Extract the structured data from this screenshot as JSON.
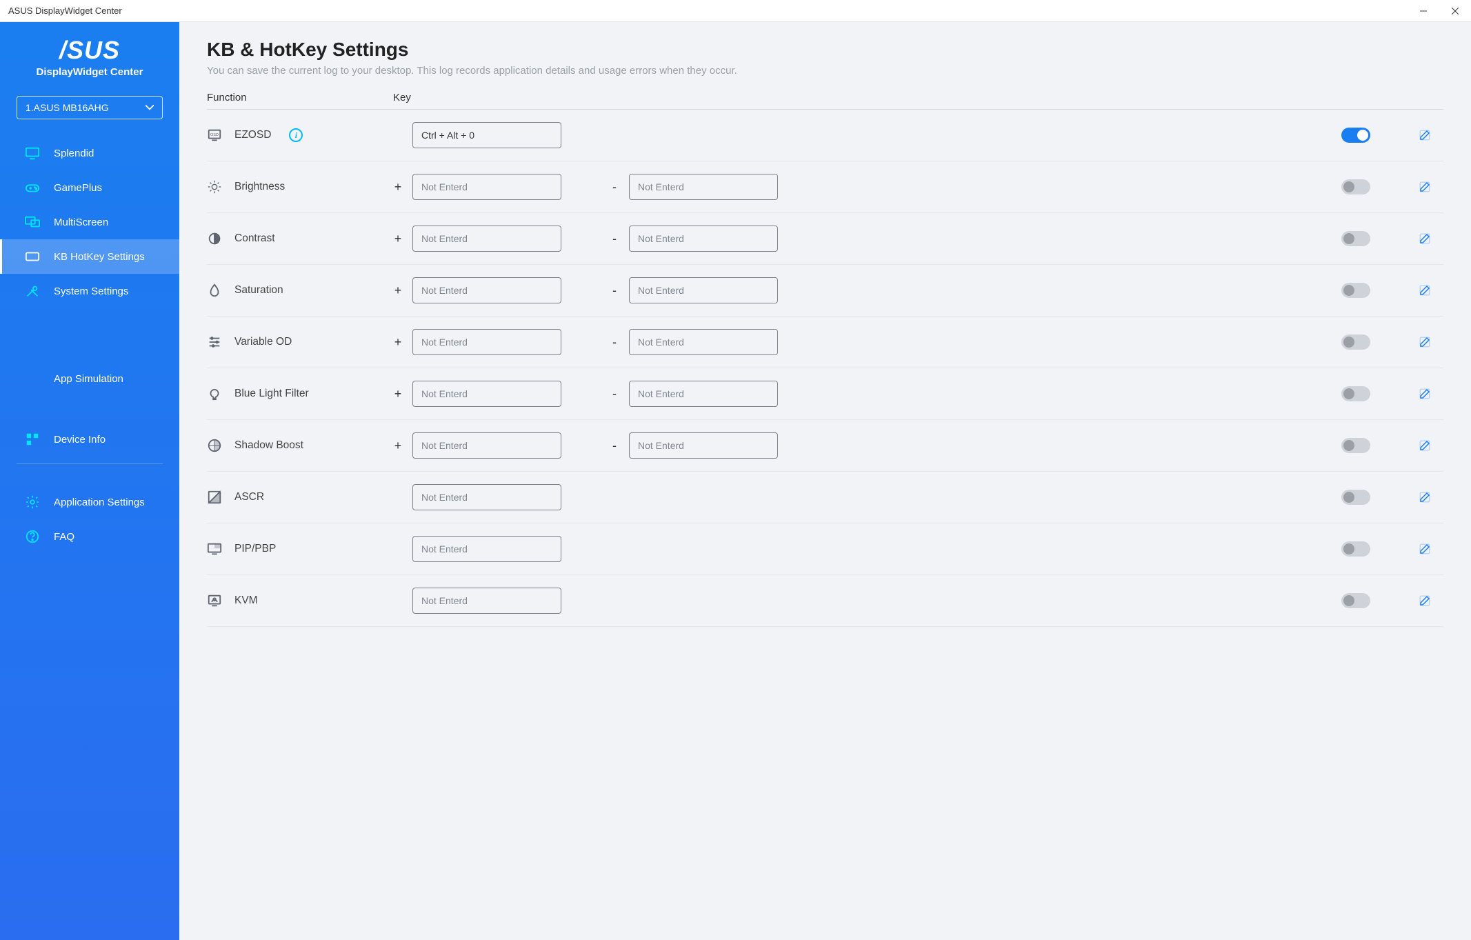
{
  "window": {
    "title": "ASUS DisplayWidget Center"
  },
  "sidebar": {
    "logo_main": "/SUS",
    "logo_sub": "DisplayWidget Center",
    "device_selected": "1.ASUS MB16AHG",
    "nav": [
      {
        "label": "Splendid"
      },
      {
        "label": "GamePlus"
      },
      {
        "label": "MultiScreen"
      },
      {
        "label": "KB HotKey Settings"
      },
      {
        "label": "System Settings"
      }
    ],
    "app_sim": "App Simulation",
    "device_info": "Device Info",
    "app_settings": "Application Settings",
    "faq": "FAQ"
  },
  "main": {
    "title": "KB & HotKey Settings",
    "subtitle": "You can save the current log to your desktop. This log records application details and usage errors when they occur.",
    "column_function": "Function",
    "column_key": "Key",
    "placeholder": "Not Enterd",
    "plus_sign": "+",
    "minus_sign": "-",
    "rows": [
      {
        "label": "EZOSD",
        "info": true,
        "single": true,
        "value": "Ctrl + Alt + 0",
        "toggle": true
      },
      {
        "label": "Brightness",
        "dual": true,
        "toggle": false
      },
      {
        "label": "Contrast",
        "dual": true,
        "toggle": false
      },
      {
        "label": "Saturation",
        "dual": true,
        "toggle": false
      },
      {
        "label": "Variable OD",
        "dual": true,
        "toggle": false
      },
      {
        "label": "Blue Light Filter",
        "dual": true,
        "toggle": false
      },
      {
        "label": "Shadow Boost",
        "dual": true,
        "toggle": false
      },
      {
        "label": "ASCR",
        "single": true,
        "toggle": false
      },
      {
        "label": "PIP/PBP",
        "single": true,
        "toggle": false
      },
      {
        "label": "KVM",
        "single": true,
        "toggle": false
      }
    ]
  }
}
